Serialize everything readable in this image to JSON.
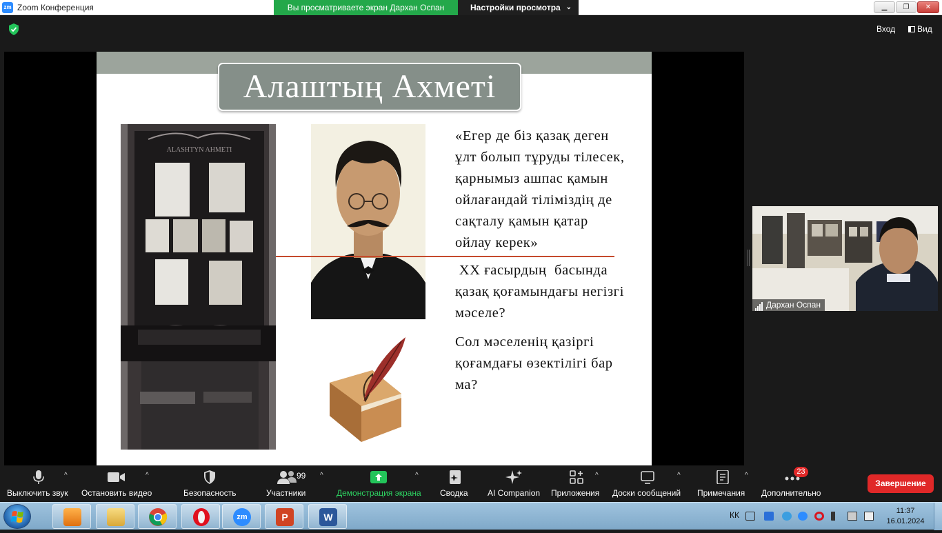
{
  "window": {
    "title": "Zoom Конференция",
    "logo_text": "zm",
    "share_banner": "Вы просматриваете экран Дархан Оспан",
    "view_options": "Настройки просмотра",
    "min_glyph": "▁",
    "max_glyph": "❐",
    "close_glyph": "✕"
  },
  "topbar": {
    "exit_fullscreen": "Вход",
    "view": "Вид"
  },
  "slide": {
    "title": "Алаштың Ахметі",
    "museum_sign": "ALASHTYN AHMETI",
    "quote_lines": [
      "«Егер де біз қазақ деген",
      "ұлт болып тұруды тілесек,",
      "қарнымыз ашпас қамын",
      "ойлағандай тіліміздің де",
      "сақталу қамын қатар",
      "ойлау керек»"
    ],
    "question1_lines": [
      " XX ғасырдың  басында",
      "қазақ қоғамындағы негізгі",
      "мәселе?"
    ],
    "question2_lines": [
      "Сол мәселенің қазіргі",
      "қоғамдағы өзектілігі бар",
      "ма?"
    ]
  },
  "speaker": {
    "name": "Дархан Оспан"
  },
  "toolbar": {
    "mute": "Выключить звук",
    "video": "Остановить видео",
    "security": "Безопасность",
    "participants": "Участники",
    "participants_count": "99",
    "share": "Демонстрация экрана",
    "summary": "Сводка",
    "ai": "AI Companion",
    "apps": "Приложения",
    "whiteboards": "Доски сообщений",
    "notes": "Примечания",
    "more": "Дополнительно",
    "more_badge": "23",
    "end": "Завершение",
    "caret": "^"
  },
  "taskbar": {
    "lang": "КК",
    "time": "11:37",
    "date": "16.01.2024",
    "zoom_text": "zm",
    "word_text": "W",
    "ppt_text": "P"
  },
  "colors": {
    "zoom_blue": "#2d8cff",
    "share_green": "#23a84a",
    "end_red": "#e02828",
    "title_box": "#858f89",
    "accent_line": "#c54a2c"
  }
}
